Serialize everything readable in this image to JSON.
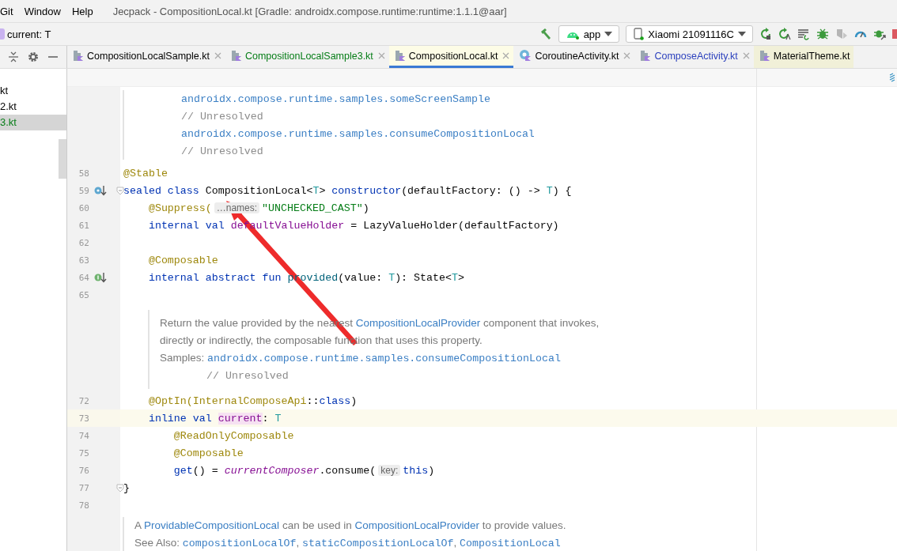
{
  "menu": [
    "Git",
    "Window",
    "Help"
  ],
  "window": {
    "title": "Jecpack - CompositionLocal.kt [Gradle: androidx.compose.runtime:runtime:1.1.1@aar]"
  },
  "breadcrumb": "current: T",
  "run_config": {
    "module": "app",
    "device": "Xiaomi 21091116C"
  },
  "tabs": [
    {
      "label": "CompositionLocalSample.kt",
      "kind": "file",
      "selected": false,
      "tinted": false,
      "closable": true,
      "color": "#000000"
    },
    {
      "label": "CompositionLocalSample3.kt",
      "kind": "file",
      "selected": false,
      "tinted": false,
      "closable": true,
      "color": "#067d17"
    },
    {
      "label": "CompositionLocal.kt",
      "kind": "file",
      "selected": true,
      "tinted": false,
      "closable": true,
      "color": "#000000"
    },
    {
      "label": "CoroutineActivity.kt",
      "kind": "class",
      "selected": false,
      "tinted": false,
      "closable": true,
      "color": "#000000"
    },
    {
      "label": "ComposeActivity.kt",
      "kind": "file",
      "selected": false,
      "tinted": false,
      "closable": true,
      "color": "#2a3fbd"
    },
    {
      "label": "MaterialTheme.kt",
      "kind": "file",
      "selected": false,
      "tinted": true,
      "closable": false,
      "color": "#000000"
    }
  ],
  "project_files": [
    {
      "label": "kt",
      "selected": false,
      "color": "#000000"
    },
    {
      "label": "2.kt",
      "selected": false,
      "color": "#000000"
    },
    {
      "label": "3.kt",
      "selected": true,
      "color": "#067d17"
    }
  ],
  "editor": {
    "blocks": [
      {
        "kind": "doc",
        "indented": false,
        "lines": [
          {
            "continued": true,
            "segments": [
              {
                "t": "androidx.compose.runtime.samples.someScreenSample",
                "kind": "code"
              }
            ]
          },
          {
            "continued": true,
            "segments": [
              {
                "t": "// Unresolved",
                "kind": "comment"
              }
            ]
          },
          {
            "continued": true,
            "segments": [
              {
                "t": "androidx.compose.runtime.samples.consumeCompositionLocal",
                "kind": "code"
              }
            ]
          },
          {
            "continued": true,
            "segments": [
              {
                "t": "// Unresolved",
                "kind": "comment"
              }
            ]
          }
        ]
      },
      {
        "kind": "code",
        "number": "58",
        "current": false,
        "fold": false,
        "segments": [
          {
            "t": "@Stable",
            "kind": "ann"
          }
        ]
      },
      {
        "kind": "code",
        "number": "59",
        "current": false,
        "fold": true,
        "marker": {
          "kind": "override"
        },
        "segments": [
          {
            "t": "sealed class ",
            "kind": "kw"
          },
          {
            "t": "CompositionLocal<",
            "kind": "plain"
          },
          {
            "t": "T",
            "kind": "type"
          },
          {
            "t": "> ",
            "kind": "plain"
          },
          {
            "t": "constructor",
            "kind": "kw"
          },
          {
            "t": "(defaultFactory: () -> ",
            "kind": "plain"
          },
          {
            "t": "T",
            "kind": "type"
          },
          {
            "t": ") {",
            "kind": "plain"
          }
        ]
      },
      {
        "kind": "code",
        "number": "60",
        "current": false,
        "fold": false,
        "segments": [
          {
            "t": "    @Suppress(",
            "kind": "ann"
          },
          {
            "t": "…names:",
            "kind": "hint"
          },
          {
            "t": "\"UNCHECKED_CAST\"",
            "kind": "str"
          },
          {
            "t": ")",
            "kind": "plain"
          }
        ]
      },
      {
        "kind": "code",
        "number": "61",
        "current": false,
        "fold": false,
        "segments": [
          {
            "t": "    internal val ",
            "kind": "kw"
          },
          {
            "t": "defaultValueHolder",
            "kind": "prop"
          },
          {
            "t": " = LazyValueHolder(defaultFactory)",
            "kind": "plain"
          }
        ]
      },
      {
        "kind": "code",
        "number": "62",
        "current": false,
        "fold": false
      },
      {
        "kind": "code",
        "number": "63",
        "current": false,
        "fold": false,
        "segments": [
          {
            "t": "    @Composable",
            "kind": "ann"
          }
        ]
      },
      {
        "kind": "code",
        "number": "64",
        "current": false,
        "fold": false,
        "marker": {
          "kind": "implemented"
        },
        "segments": [
          {
            "t": "    internal abstract fun ",
            "kind": "kw"
          },
          {
            "t": "provided",
            "kind": "fn"
          },
          {
            "t": "(value: ",
            "kind": "plain"
          },
          {
            "t": "T",
            "kind": "type"
          },
          {
            "t": "): State<",
            "kind": "plain"
          },
          {
            "t": "T",
            "kind": "type"
          },
          {
            "t": ">",
            "kind": "plain"
          }
        ]
      },
      {
        "kind": "code",
        "number": "65",
        "current": false,
        "fold": false
      },
      {
        "kind": "doc",
        "indented": true,
        "lines": [
          {
            "continued": false,
            "segments": [
              {
                "t": "Return the value provided by the nearest ",
                "kind": "text"
              },
              {
                "t": "CompositionLocalProvider",
                "kind": "link"
              },
              {
                "t": " component that invokes,",
                "kind": "text"
              }
            ]
          },
          {
            "continued": false,
            "segments": [
              {
                "t": "directly or indirectly, the composable function that uses this property.",
                "kind": "text"
              }
            ]
          },
          {
            "continued": false,
            "segments": [
              {
                "t": "Samples: ",
                "kind": "text"
              },
              {
                "t": "androidx.compose.runtime.samples.consumeCompositionLocal",
                "kind": "code"
              }
            ]
          },
          {
            "continued": true,
            "segments": [
              {
                "t": "// Unresolved",
                "kind": "comment"
              }
            ]
          }
        ]
      },
      {
        "kind": "code",
        "number": "72",
        "current": false,
        "fold": false,
        "segments": [
          {
            "t": "    @OptIn(InternalComposeApi",
            "kind": "ann"
          },
          {
            "t": "::",
            "kind": "plain"
          },
          {
            "t": "class",
            "kind": "kw"
          },
          {
            "t": ")",
            "kind": "plain"
          }
        ]
      },
      {
        "kind": "code",
        "number": "73",
        "current": true,
        "fold": false,
        "segments": [
          {
            "t": "    inline val ",
            "kind": "kw"
          },
          {
            "t": "current",
            "kind": "mark"
          },
          {
            "t": ": ",
            "kind": "plain"
          },
          {
            "t": "T",
            "kind": "type"
          }
        ]
      },
      {
        "kind": "code",
        "number": "74",
        "current": false,
        "fold": false,
        "segments": [
          {
            "t": "        @ReadOnlyComposable",
            "kind": "ann"
          }
        ]
      },
      {
        "kind": "code",
        "number": "75",
        "current": false,
        "fold": false,
        "segments": [
          {
            "t": "        @Composable",
            "kind": "ann"
          }
        ]
      },
      {
        "kind": "code",
        "number": "76",
        "current": false,
        "fold": false,
        "segments": [
          {
            "t": "        get",
            "kind": "kw"
          },
          {
            "t": "() = ",
            "kind": "plain"
          },
          {
            "t": "currentComposer",
            "kind": "italic"
          },
          {
            "t": ".consume(",
            "kind": "plain"
          },
          {
            "t": "key:",
            "kind": "hint"
          },
          {
            "t": "this",
            "kind": "kw"
          },
          {
            "t": ")",
            "kind": "plain"
          }
        ]
      },
      {
        "kind": "code",
        "number": "77",
        "current": false,
        "fold": true,
        "segments": [
          {
            "t": "}",
            "kind": "plain"
          }
        ]
      },
      {
        "kind": "code",
        "number": "78",
        "current": false,
        "fold": false
      },
      {
        "kind": "doc",
        "indented": false,
        "lines": [
          {
            "continued": false,
            "segments": [
              {
                "t": "A ",
                "kind": "text"
              },
              {
                "t": "ProvidableCompositionLocal",
                "kind": "link"
              },
              {
                "t": " can be used in ",
                "kind": "text"
              },
              {
                "t": "CompositionLocalProvider",
                "kind": "link"
              },
              {
                "t": " to provide values.",
                "kind": "text"
              }
            ]
          },
          {
            "continued": false,
            "segments": [
              {
                "t": "See Also: ",
                "kind": "text"
              },
              {
                "t": "compositionLocalOf",
                "kind": "code"
              },
              {
                "t": ", ",
                "kind": "text"
              },
              {
                "t": "staticCompositionLocalOf",
                "kind": "code"
              },
              {
                "t": ", ",
                "kind": "text"
              },
              {
                "t": "CompositionLocal",
                "kind": "code"
              }
            ]
          }
        ]
      }
    ]
  }
}
